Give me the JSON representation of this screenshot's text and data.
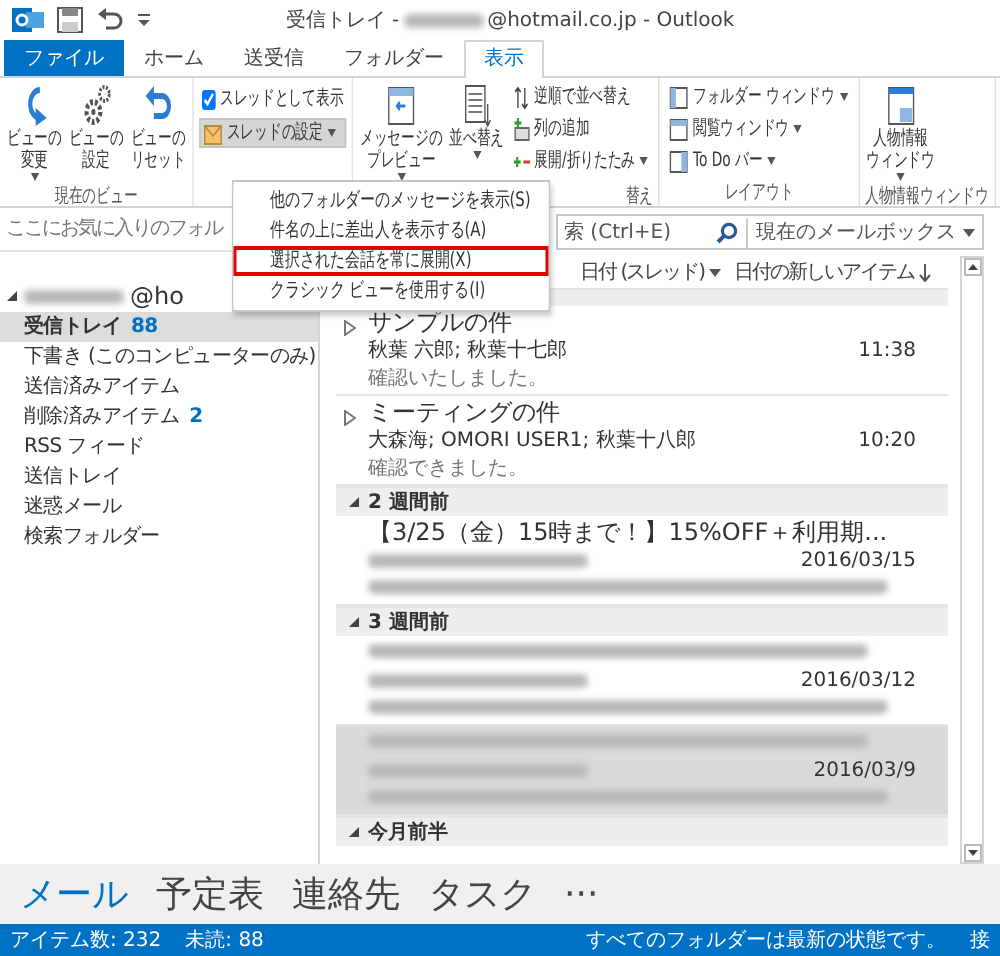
{
  "title_bar": {
    "title_start": "受信トレイ -",
    "title_end": "@hotmail.co.jp - Outlook"
  },
  "tabs": [
    {
      "label": "ファイル",
      "kind": "file",
      "selected": false
    },
    {
      "label": "ホーム",
      "kind": "tab",
      "selected": false
    },
    {
      "label": "送受信",
      "kind": "tab",
      "selected": false
    },
    {
      "label": "フォルダー",
      "kind": "tab",
      "selected": false
    },
    {
      "label": "表示",
      "kind": "tab",
      "selected": true
    }
  ],
  "ribbon": {
    "groups": [
      {
        "label": "現在のビュー",
        "columns": [
          [
            {
              "kind": "large",
              "label": "ビューの変更",
              "dropdown": true
            }
          ],
          [
            {
              "kind": "large",
              "label": "ビューの設定",
              "dropdown": false
            }
          ],
          [
            {
              "kind": "large",
              "label": "ビューのリセット",
              "dropdown": false
            }
          ]
        ]
      },
      {
        "columns": [
          [
            {
              "kind": "check",
              "label": "スレッドとして表示",
              "checked": true
            },
            {
              "kind": "small",
              "label": "スレッドの設定",
              "dropdown": true,
              "pressed": true
            }
          ]
        ]
      },
      {
        "label": "替え",
        "columns": [
          [
            {
              "kind": "large",
              "label": "メッセージのプレビュー",
              "dropdown": true
            }
          ],
          [
            {
              "kind": "large",
              "label": "並べ替え",
              "dropdown": true
            }
          ],
          [
            {
              "kind": "small",
              "label": "逆順で並べ替え",
              "dropdown": false,
              "pressed": false
            },
            {
              "kind": "small",
              "label": "列の追加",
              "dropdown": false,
              "pressed": false
            },
            {
              "kind": "small",
              "label": "展開/折りたたみ",
              "dropdown": true,
              "pressed": false
            }
          ]
        ]
      },
      {
        "label": "レイアウト",
        "columns": [
          [
            {
              "kind": "small",
              "label": "フォルダー ウィンドウ",
              "dropdown": true,
              "pressed": false
            },
            {
              "kind": "small",
              "label": "閲覧ウィンドウ",
              "dropdown": true,
              "pressed": false
            },
            {
              "kind": "small",
              "label": "To Do バー",
              "dropdown": true,
              "pressed": false
            }
          ]
        ]
      },
      {
        "label": "人物情報ウィンドウ",
        "columns": [
          [
            {
              "kind": "large",
              "label": "人物情報ウィンドウ",
              "dropdown": true
            }
          ]
        ]
      }
    ]
  },
  "thread_menu": {
    "items": [
      {
        "label": "他のフォルダーのメッセージを表示(S)",
        "outlined": false
      },
      {
        "label": "件名の上に差出人を表示する(A)",
        "outlined": false
      },
      {
        "label": "選択された会話を常に展開(X)",
        "outlined": true
      },
      {
        "label": "クラシック ビューを使用する(I)",
        "outlined": false
      }
    ]
  },
  "folder_pane": {
    "favorites_hint": "ここにお気に入りのフォル",
    "account": {
      "name_end": "@ho",
      "expanded": true
    },
    "folders": [
      {
        "label": "受信トレイ",
        "count": "88",
        "selected": true
      },
      {
        "label": "下書き (このコンピューターのみ)",
        "selected": false
      },
      {
        "label": "送信済みアイテム",
        "selected": false
      },
      {
        "label": "削除済みアイテム",
        "count": "2",
        "selected": false
      },
      {
        "label": "RSS フィード",
        "selected": false
      },
      {
        "label": "送信トレイ",
        "selected": false
      },
      {
        "label": "迷惑メール",
        "selected": false
      },
      {
        "label": "検索フォルダー",
        "selected": false
      }
    ]
  },
  "search": {
    "placeholder": "索 (Ctrl+E)",
    "scope": "現在のメールボックス"
  },
  "mail_list": {
    "sort": "日付 (スレッド)",
    "order": "日付の新しいアイテム",
    "groups": [
      {
        "expanded": true,
        "items": [
          {
            "thread": true,
            "subject": "サンプルの件",
            "from": "秋葉 六郎; 秋葉十七郎",
            "preview": "確認いたしました。",
            "time": "11:38",
            "selected": false
          },
          {
            "thread": true,
            "subject": "ミーティングの件",
            "from": "大森海; OMORI USER1; 秋葉十八郎",
            "preview": "確認できました。",
            "time": "10:20",
            "selected": false
          }
        ]
      },
      {
        "label": "2 週間前",
        "expanded": true,
        "items": [
          {
            "thread": false,
            "subject": "【3/25（金）15時まで！】15%OFF＋利用期...",
            "time": "2016/03/15",
            "selected": false
          }
        ]
      },
      {
        "label": "3 週間前",
        "expanded": true,
        "items": [
          {
            "thread": false,
            "time": "2016/03/12",
            "selected": false
          },
          {
            "thread": false,
            "time": "2016/03/9",
            "selected": true
          }
        ]
      },
      {
        "label": "今月前半",
        "expanded": true
      }
    ]
  },
  "nav": [
    {
      "label": "メール",
      "selected": true
    },
    {
      "label": "予定表",
      "selected": false
    },
    {
      "label": "連絡先",
      "selected": false
    },
    {
      "label": "タスク",
      "selected": false
    },
    {
      "label": "···",
      "selected": false
    }
  ],
  "status_bar": {
    "items": "アイテム数: 232",
    "unread": "未読: 88",
    "sync": "すべてのフォルダーは最新の状態です。",
    "connection": "接"
  }
}
